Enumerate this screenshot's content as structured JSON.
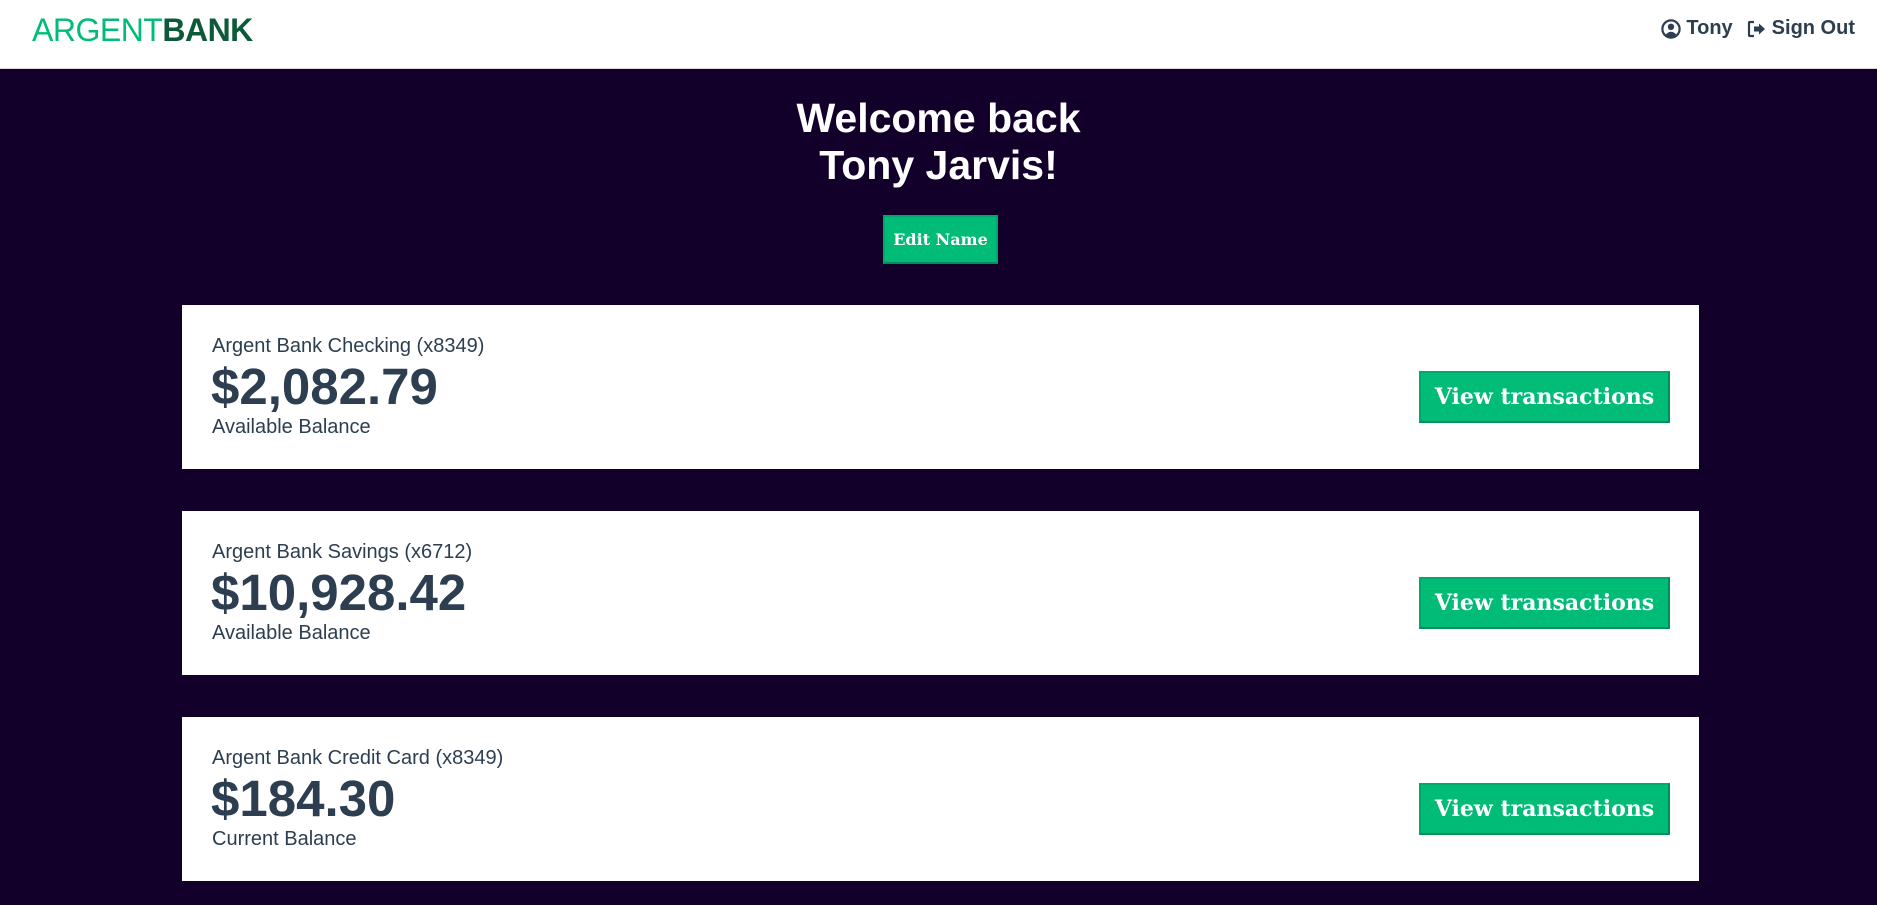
{
  "nav": {
    "logo_part1": "ARGENT",
    "logo_part2": "BANK",
    "user_label": "Tony",
    "user_icon": "user-circle-icon",
    "signout_label": "Sign Out",
    "signout_icon": "sign-out-icon"
  },
  "header": {
    "line1": "Welcome back",
    "line2": "Tony Jarvis!",
    "edit_button": "Edit Name"
  },
  "accounts": [
    {
      "title": "Argent Bank Checking (x8349)",
      "amount": "$2,082.79",
      "description": "Available Balance",
      "button": "View transactions"
    },
    {
      "title": "Argent Bank Savings (x6712)",
      "amount": "$10,928.42",
      "description": "Available Balance",
      "button": "View transactions"
    },
    {
      "title": "Argent Bank Credit Card (x8349)",
      "amount": "$184.30",
      "description": "Current Balance",
      "button": "View transactions"
    }
  ],
  "colors": {
    "background": "#12002b",
    "accent": "#00bc77",
    "logo_dark": "#0c5a39",
    "text": "#2c3e50"
  }
}
